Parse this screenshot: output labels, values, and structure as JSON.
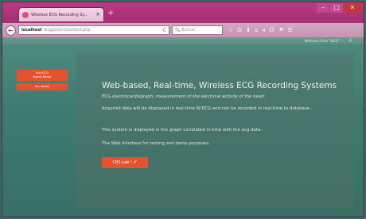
{
  "browser": {
    "tab_title": "Wireless ECG Recording Sy...",
    "tab_close": "×",
    "new_tab": "+",
    "window_buttons": {
      "minimize": "–",
      "maximize": "□",
      "close": "✕"
    },
    "back": "←",
    "url_host": "localhost",
    "url_path": "/ecg/pisoni/content.php",
    "reload": "C",
    "search_placeholder": "Buscar",
    "search_icon": "🔍",
    "toolbar_icons": [
      "☆",
      "⊡",
      "⬇",
      "⌂",
      "◂",
      "☺",
      "⚑",
      "☰"
    ]
  },
  "page": {
    "welcome": "Welcome Enter 'WELT'",
    "user_icon": "♙",
    "sidebar": [
      {
        "label": "Run ECG\nlayout Never"
      },
      {
        "label": "Run Never"
      }
    ],
    "title": "Web-based, Real-time, Wireless ECG Recording Systems",
    "subtitle": "ECG electrocardiograph, measurement of the electrical activity of the heart.",
    "paragraphs": [
      "Acquired data will be displayed in real-time W-ECG and can be recorded in real-time to database .",
      "This system is displayed in the graph correlated in time with the ecg data.",
      "The Web Interface for testing and demo purposes."
    ],
    "cta_label": "CBS-Lab !",
    "cta_icon": "✔"
  },
  "colors": {
    "accent": "#e7522e",
    "browser_chrome": "#9a2a6b",
    "page_bg": "#3c7a70"
  }
}
